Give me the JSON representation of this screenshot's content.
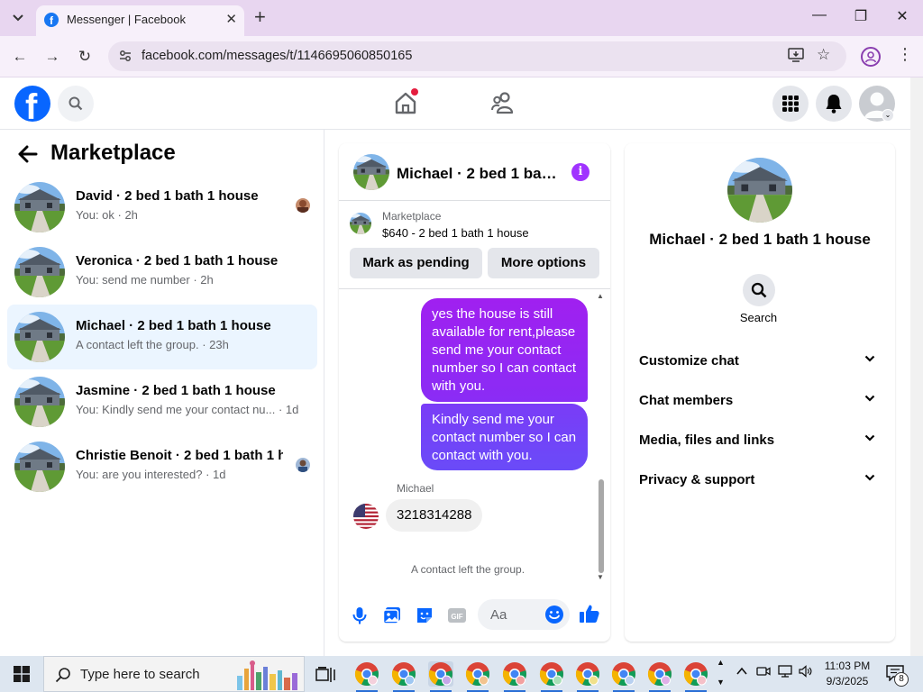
{
  "browser": {
    "tab_title": "Messenger | Facebook",
    "url": "facebook.com/messages/t/1146695060850165",
    "new_tab_label": "+"
  },
  "left": {
    "title": "Marketplace",
    "conversations": [
      {
        "name": "David · 2 bed 1 bath 1 house",
        "preview": "You: ok · 2h",
        "active": false
      },
      {
        "name": "Veronica · 2 bed 1 bath 1 house",
        "preview": "You: send me number · 2h",
        "active": false
      },
      {
        "name": "Michael · 2 bed 1 bath 1 house",
        "preview": "A contact left the group. · 23h",
        "active": true
      },
      {
        "name": "Jasmine · 2 bed 1 bath 1 house",
        "preview": "You: Kindly send me your contact nu...  · 1d",
        "active": false
      },
      {
        "name": "Christie Benoit · 2 bed 1 bath 1 h...",
        "preview": "You: are you interested? · 1d",
        "active": false
      }
    ]
  },
  "chat": {
    "title": "Michael · 2 bed 1 bat...",
    "listing_source": "Marketplace",
    "listing_title": "$640 - 2 bed 1 bath 1 house",
    "mark_pending_label": "Mark as pending",
    "more_options_label": "More options",
    "messages": [
      {
        "from": "me",
        "text": "yes the house is still available for rent,please send me your contact number so I can contact with you."
      },
      {
        "from": "me",
        "text": "Kindly send me your contact number so I can contact with you."
      },
      {
        "from": "Michael",
        "sender_label": "Michael",
        "text": "3218314288"
      }
    ],
    "system_message": "A contact left the group.",
    "composer_placeholder": "Aa"
  },
  "info": {
    "name": "Michael · 2 bed 1 bath 1 house",
    "search_label": "Search",
    "sections": [
      "Customize chat",
      "Chat members",
      "Media, files and links",
      "Privacy & support"
    ]
  },
  "taskbar": {
    "search_placeholder": "Type here to search",
    "time": "11:03 PM",
    "date": "9/3/2025",
    "notification_count": "8"
  },
  "colors": {
    "fb_blue": "#0866ff",
    "messenger_purple": "#a033ff",
    "active_conv_bg": "#ebf5ff",
    "notification_red": "#e41e3f"
  }
}
